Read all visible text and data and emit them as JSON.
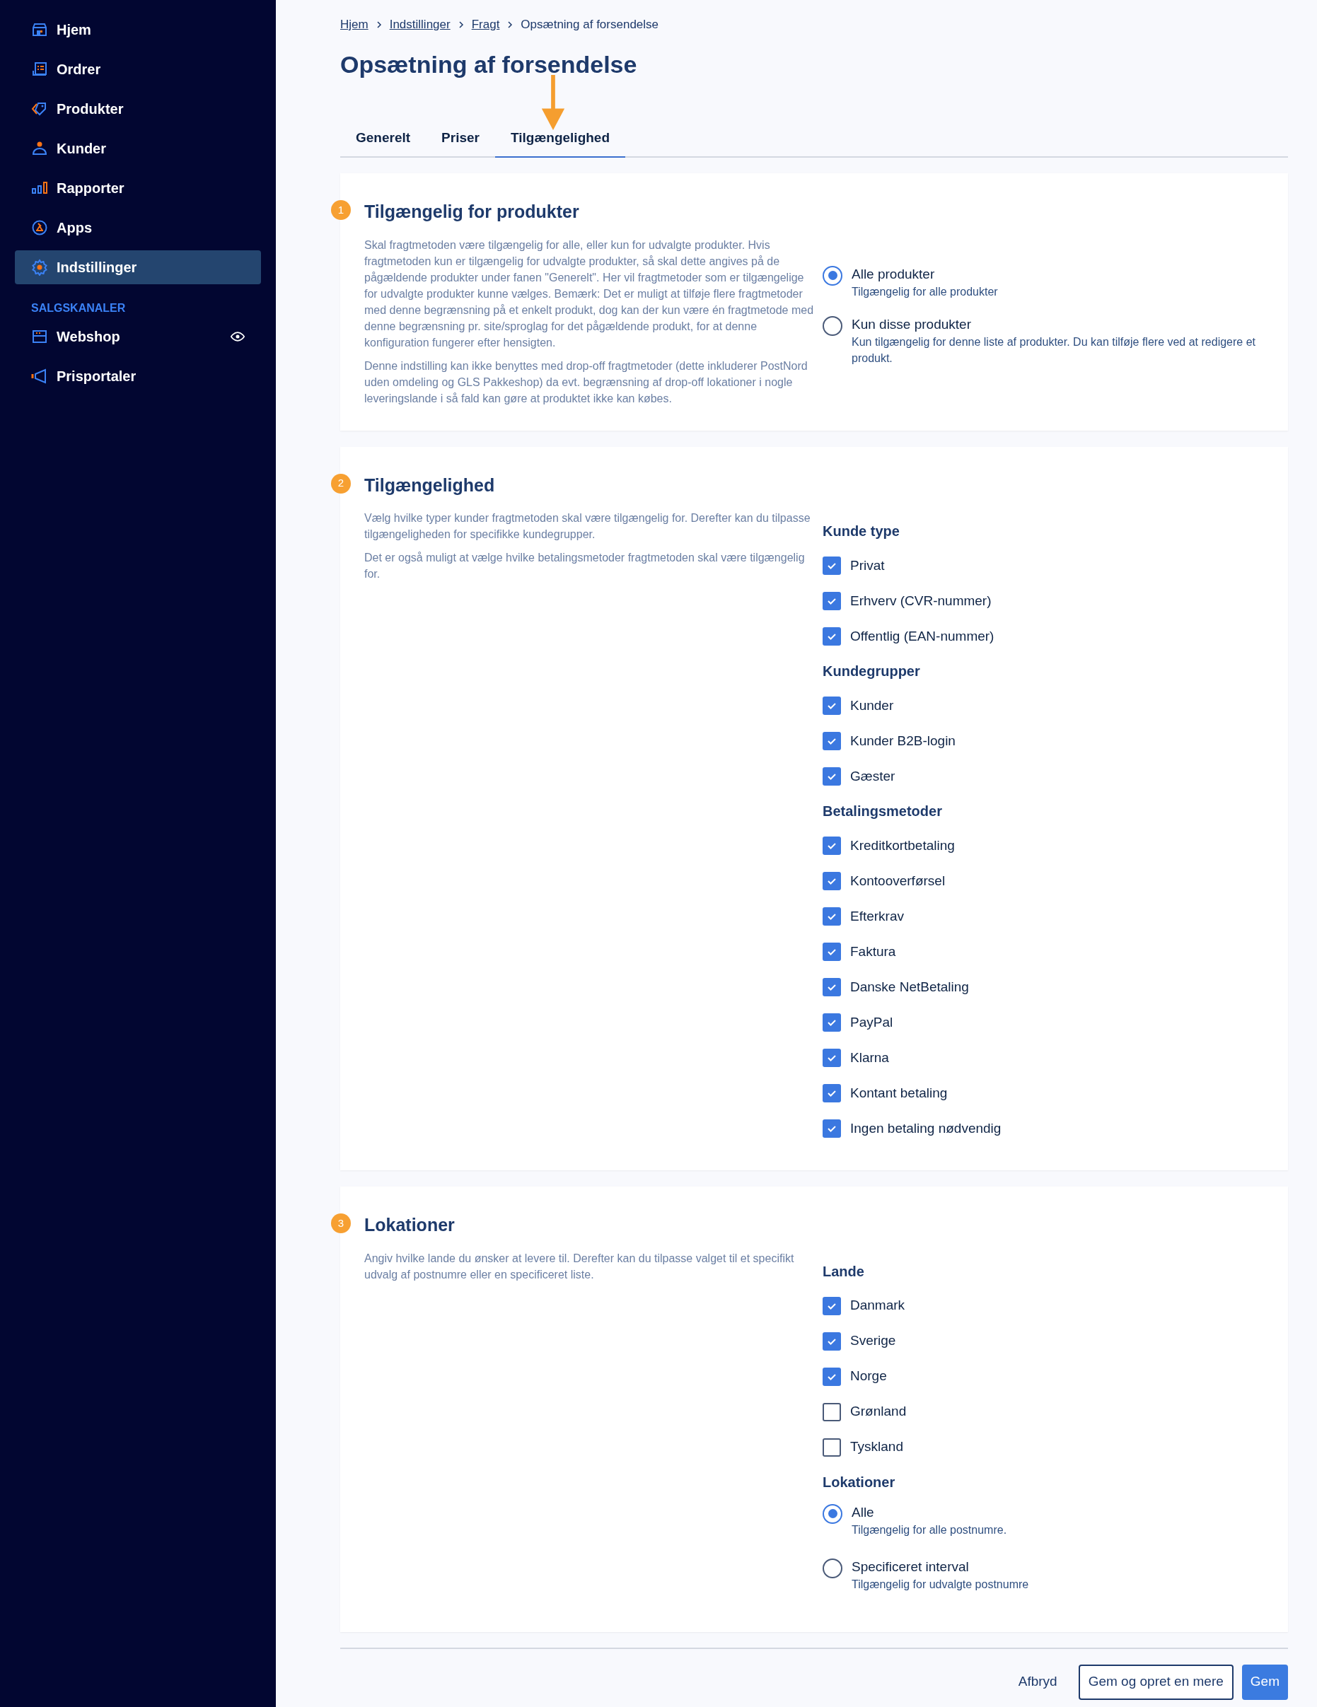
{
  "sidebar": {
    "items": [
      {
        "label": "Hjem",
        "selected": false
      },
      {
        "label": "Ordrer",
        "selected": false
      },
      {
        "label": "Produkter",
        "selected": false
      },
      {
        "label": "Kunder",
        "selected": false
      },
      {
        "label": "Rapporter",
        "selected": false
      },
      {
        "label": "Apps",
        "selected": false
      },
      {
        "label": "Indstillinger",
        "selected": true
      }
    ],
    "section_label": "SALGSKANALER",
    "channels": [
      {
        "label": "Webshop",
        "visible": true
      },
      {
        "label": "Prisportaler",
        "visible": false
      }
    ]
  },
  "breadcrumb": [
    {
      "label": "Hjem",
      "link": true
    },
    {
      "label": "Indstillinger",
      "link": true
    },
    {
      "label": "Fragt",
      "link": true
    },
    {
      "label": "Opsætning af forsendelse",
      "link": false
    }
  ],
  "page_title": "Opsætning af forsendelse",
  "tabs": [
    {
      "label": "Generelt",
      "selected": false
    },
    {
      "label": "Priser",
      "selected": false
    },
    {
      "label": "Tilgængelighed",
      "selected": true
    }
  ],
  "sections": [
    {
      "number": "1",
      "title": "Tilgængelig for produkter",
      "paragraphs": [
        "Skal fragtmetoden være tilgængelig for alle, eller kun for udvalgte produkter. Hvis fragtmetoden kun er tilgængelig for udvalgte produkter, så skal dette angives på de pågældende produkter under fanen \"Generelt\". Her vil fragtmetoder som er tilgængelige for udvalgte produkter kunne vælges. Bemærk: Det er muligt at tilføje flere fragtmetoder med denne begrænsning på et enkelt produkt, dog kan der kun være én fragtmetode med denne begrænsning pr. site/sproglag for det pågældende produkt, for at denne konfiguration fungerer efter hensigten.",
        "Denne indstilling kan ikke benyttes med drop-off fragtmetoder (dette inkluderer PostNord uden omdeling og GLS Pakkeshop) da evt. begrænsning af drop-off lokationer i nogle leveringslande i så fald kan gøre at produktet ikke kan købes."
      ],
      "groups": [
        {
          "items": [
            {
              "kind": "radio",
              "label": "Alle produkter",
              "description": "Tilgængelig for alle produkter",
              "selected": true
            },
            {
              "kind": "radio",
              "label": "Kun disse produkter",
              "description": "Kun tilgængelig for denne liste af produkter. Du kan tilføje flere ved at redigere et produkt.",
              "selected": false
            }
          ]
        }
      ]
    },
    {
      "number": "2",
      "title": "Tilgængelighed",
      "paragraphs": [
        "Vælg hvilke typer kunder fragtmetoden skal være tilgængelig for. Derefter kan du tilpasse tilgængeligheden for specifikke kundegrupper.",
        "Det er også muligt at vælge hvilke betalingsmetoder fragtmetoden skal være tilgængelig for."
      ],
      "groups": [
        {
          "heading": "Kunde type",
          "items": [
            {
              "kind": "checkbox",
              "label": "Privat",
              "checked": true
            },
            {
              "kind": "checkbox",
              "label": "Erhverv (CVR-nummer)",
              "checked": true
            },
            {
              "kind": "checkbox",
              "label": "Offentlig (EAN-nummer)",
              "checked": true
            }
          ]
        },
        {
          "heading": "Kundegrupper",
          "items": [
            {
              "kind": "checkbox",
              "label": "Kunder",
              "checked": true
            },
            {
              "kind": "checkbox",
              "label": "Kunder B2B-login",
              "checked": true
            },
            {
              "kind": "checkbox",
              "label": "Gæster",
              "checked": true
            }
          ]
        },
        {
          "heading": "Betalingsmetoder",
          "items": [
            {
              "kind": "checkbox",
              "label": "Kreditkortbetaling",
              "checked": true
            },
            {
              "kind": "checkbox",
              "label": "Kontooverførsel",
              "checked": true
            },
            {
              "kind": "checkbox",
              "label": "Efterkrav",
              "checked": true
            },
            {
              "kind": "checkbox",
              "label": "Faktura",
              "checked": true
            },
            {
              "kind": "checkbox",
              "label": "Danske NetBetaling",
              "checked": true
            },
            {
              "kind": "checkbox",
              "label": "PayPal",
              "checked": true
            },
            {
              "kind": "checkbox",
              "label": "Klarna",
              "checked": true
            },
            {
              "kind": "checkbox",
              "label": "Kontant betaling",
              "checked": true
            },
            {
              "kind": "checkbox",
              "label": "Ingen betaling nødvendig",
              "checked": true
            }
          ]
        }
      ]
    },
    {
      "number": "3",
      "title": "Lokationer",
      "paragraphs": [
        "Angiv hvilke lande du ønsker at levere til. Derefter kan du tilpasse valget til et specifikt udvalg af postnumre eller en specificeret liste."
      ],
      "groups": [
        {
          "heading": "Lande",
          "items": [
            {
              "kind": "checkbox",
              "label": "Danmark",
              "checked": true
            },
            {
              "kind": "checkbox",
              "label": "Sverige",
              "checked": true
            },
            {
              "kind": "checkbox",
              "label": "Norge",
              "checked": true
            },
            {
              "kind": "checkbox",
              "label": "Grønland",
              "checked": false
            },
            {
              "kind": "checkbox",
              "label": "Tyskland",
              "checked": false
            }
          ]
        },
        {
          "heading": "Lokationer",
          "items": [
            {
              "kind": "radio",
              "label": "Alle",
              "description": "Tilgængelig for alle postnumre.",
              "selected": true
            },
            {
              "kind": "radio",
              "label": "Specificeret interval",
              "description": "Tilgængelig for udvalgte postnumre",
              "selected": false
            }
          ]
        }
      ]
    }
  ],
  "actions": [
    {
      "label": "Afbryd",
      "kind": "link"
    },
    {
      "label": "Gem og opret en mere",
      "kind": "secondary"
    },
    {
      "label": "Gem",
      "kind": "primary"
    }
  ]
}
